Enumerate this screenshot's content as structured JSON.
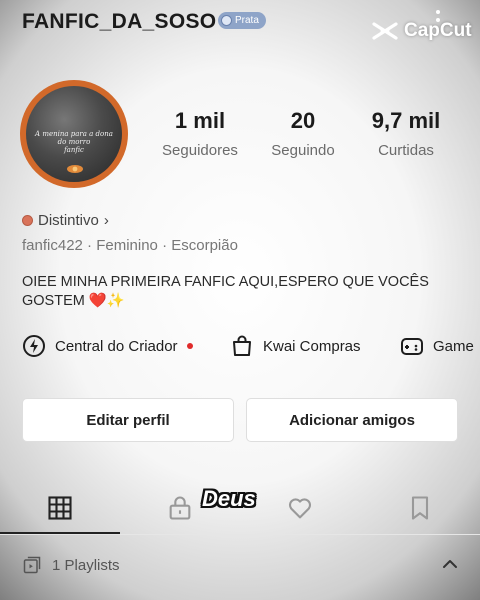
{
  "header": {
    "username": "FANFIC_DA_SOSO",
    "level_badge": "Prata",
    "watermark": "CapCut"
  },
  "avatar": {
    "caption_lines": [
      "A menina para a dona",
      "do morro",
      "fanfic"
    ]
  },
  "stats": [
    {
      "value": "1 mil",
      "label": "Seguidores"
    },
    {
      "value": "20",
      "label": "Seguindo"
    },
    {
      "value": "9,7 mil",
      "label": "Curtidas"
    }
  ],
  "profile": {
    "badge_label": "Distintivo",
    "badge_chevron": "›",
    "meta": "fanfic422 · Feminino · Escorpião",
    "bio_line1": "OIEE MINHA PRIMEIRA FANFIC AQUI,ESPERO QUE VOCÊS",
    "bio_line2": "GOSTEM ❤️✨"
  },
  "shortcuts": [
    {
      "label": "Central do Criador",
      "icon": "creator-center-icon",
      "has_dot": true
    },
    {
      "label": "Kwai Compras",
      "icon": "shopping-bag-icon",
      "has_dot": false
    },
    {
      "label": "Game",
      "icon": "gamepad-icon",
      "has_dot": false
    }
  ],
  "actions": {
    "edit_profile": "Editar perfil",
    "add_friends": "Adicionar amigos"
  },
  "tabs": [
    {
      "name": "grid",
      "icon": "grid-icon",
      "active": true
    },
    {
      "name": "private",
      "icon": "lock-icon",
      "active": false
    },
    {
      "name": "liked",
      "icon": "heart-icon",
      "active": false
    },
    {
      "name": "saved",
      "icon": "bookmark-icon",
      "active": false
    }
  ],
  "sticker_text": "Deus",
  "playlists": {
    "label": "1 Playlists"
  },
  "colors": {
    "avatar_ring": "#d2692a",
    "badge": "#8ea4c8",
    "notification_dot": "#e02a2a"
  }
}
